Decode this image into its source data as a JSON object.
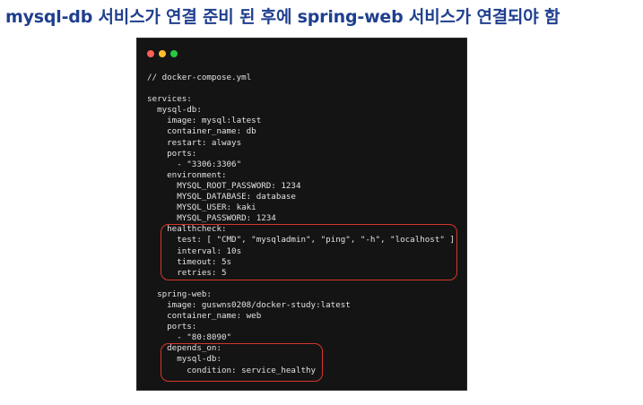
{
  "heading": "mysql-db 서비스가 연결 준비 된 후에 spring-web 서비스가 연결되야 함",
  "window": {
    "dots": [
      {
        "name": "close-dot",
        "color": "#ff5f56"
      },
      {
        "name": "minimize-dot",
        "color": "#ffbd2e"
      },
      {
        "name": "maximize-dot",
        "color": "#27c93f"
      }
    ]
  },
  "code": {
    "lines": [
      "// docker-compose.yml",
      "",
      "services:",
      "  mysql-db:",
      "    image: mysql:latest",
      "    container_name: db",
      "    restart: always",
      "    ports:",
      "      - \"3306:3306\"",
      "    environment:",
      "      MYSQL_ROOT_PASSWORD: 1234",
      "      MYSQL_DATABASE: database",
      "      MYSQL_USER: kaki",
      "      MYSQL_PASSWORD: 1234",
      "    healthcheck:",
      "      test: [ \"CMD\", \"mysqladmin\", \"ping\", \"-h\", \"localhost\" ]",
      "      interval: 10s",
      "      timeout: 5s",
      "      retries: 5",
      "",
      "  spring-web:",
      "    image: guswns0208/docker-study:latest",
      "    container_name: web",
      "    ports:",
      "      - \"80:8090\"",
      "    depends_on:",
      "      mysql-db:",
      "        condition: service_healthy"
    ]
  },
  "highlight_color": "#d5372b"
}
